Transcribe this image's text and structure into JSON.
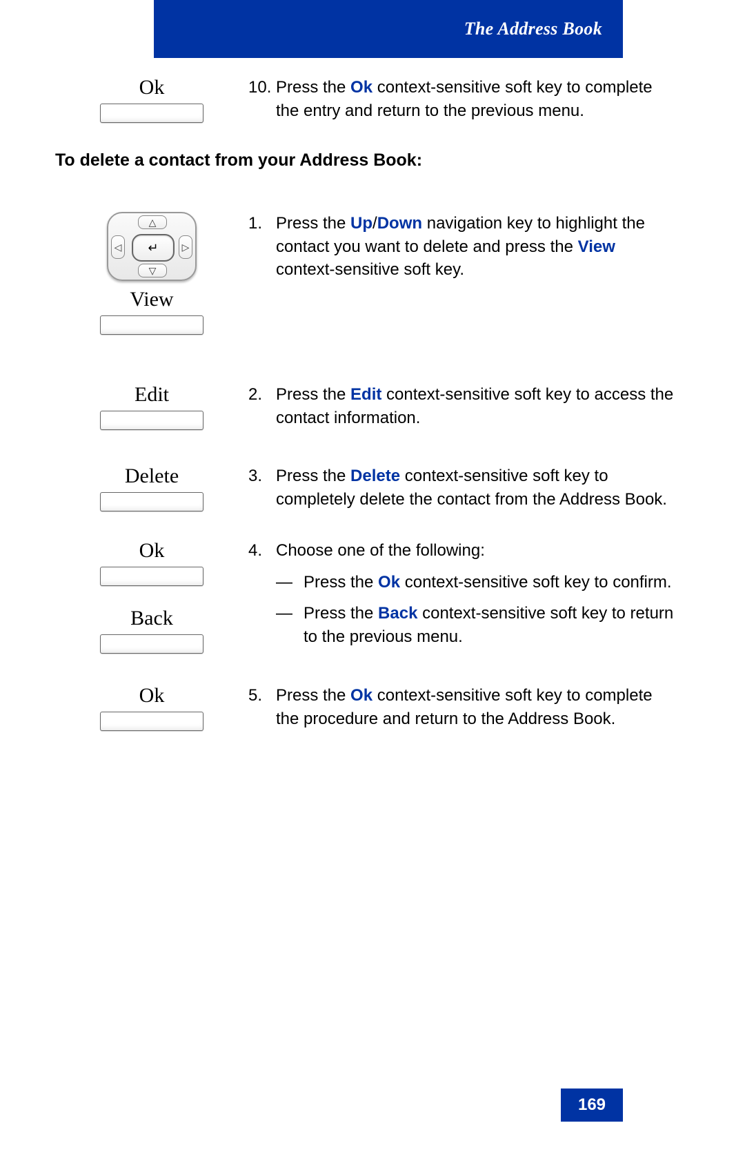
{
  "header": {
    "title": "The Address Book"
  },
  "page_number": "169",
  "softkeys": {
    "ok": "Ok",
    "view": "View",
    "edit": "Edit",
    "delete": "Delete",
    "back": "Back"
  },
  "key_emph": {
    "ok": "Ok",
    "up": "Up",
    "down": "Down",
    "view": "View",
    "edit": "Edit",
    "delete": "Delete",
    "back": "Back"
  },
  "top_step": {
    "num": "10.",
    "before": "  Press the ",
    "after": " context-sensitive soft key to complete the entry and return to the previous menu."
  },
  "section_heading": "To delete a contact from your Address Book:",
  "steps": {
    "s1": {
      "num": "1.",
      "p1": "Press the ",
      "p2": "/",
      "p3": " navigation key to highlight the contact you want to delete and press the ",
      "p4": " context-sensitive soft key."
    },
    "s2": {
      "num": "2.",
      "p1": "Press the ",
      "p2": " context-sensitive soft key to access the contact information."
    },
    "s3": {
      "num": "3.",
      "p1": "Press the ",
      "p2": " context-sensitive soft key to completely delete the contact from the Address Book."
    },
    "s4": {
      "num": "4.",
      "intro": "Choose one of the following:",
      "a1": "Press the ",
      "a2": " context-sensitive soft key to confirm.",
      "b1": "Press the ",
      "b2": " context-sensitive soft key to return to the previous menu."
    },
    "s5": {
      "num": "5.",
      "p1": "Press the ",
      "p2": " context-sensitive soft key to complete the procedure and return to the Address Book."
    }
  },
  "dash": "—"
}
